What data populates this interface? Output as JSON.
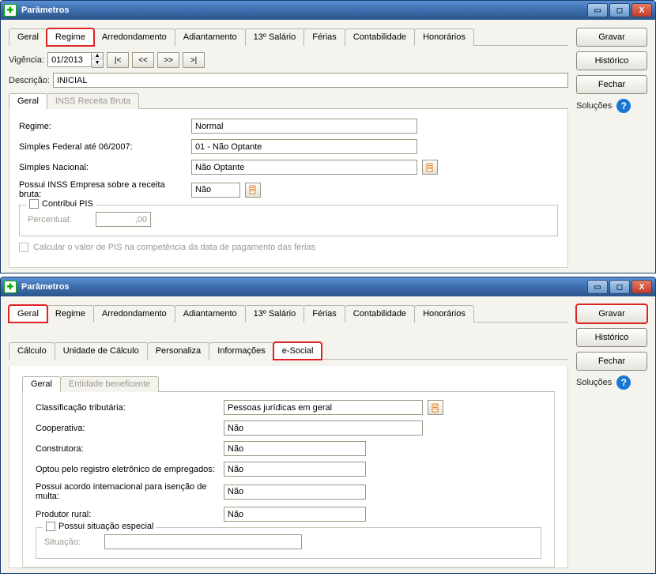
{
  "window_title": "Parâmetros",
  "window_buttons": {
    "min": "▭",
    "max": "◻",
    "close": "X"
  },
  "top": {
    "tabs": [
      "Geral",
      "Regime",
      "Arredondamento",
      "Adiantamento",
      "13º Salário",
      "Férias",
      "Contabilidade",
      "Honorários"
    ],
    "active_tab": 1,
    "vigencia_label": "Vigência:",
    "vigencia_value": "01/2013",
    "nav": {
      "first": "|<",
      "prev": "<<",
      "next": ">>",
      "last": ">|"
    },
    "descricao_label": "Descrição:",
    "descricao_value": "INICIAL",
    "subtabs": [
      "Geral",
      "INSS Receita Bruta"
    ],
    "subtab_active": 0,
    "fields": {
      "regime_label": "Regime:",
      "regime_value": "Normal",
      "simples_fed_label": "Simples Federal até 06/2007:",
      "simples_fed_value": "01 - Não Optante",
      "simples_nac_label": "Simples Nacional:",
      "simples_nac_value": "Não Optante",
      "inss_receita_label": "Possui INSS Empresa sobre a receita bruta:",
      "inss_receita_value": "Não",
      "contribui_pis_label": "Contribui PIS",
      "percentual_label": "Percentual:",
      "percentual_value": ",00",
      "calcular_pis_label": "Calcular o valor de PIS na competência da data de pagamento das férias"
    },
    "side": {
      "gravar": "Gravar",
      "historico": "Histórico",
      "fechar": "Fechar",
      "solucoes": "Soluções"
    }
  },
  "bottom": {
    "tabs": [
      "Geral",
      "Regime",
      "Arredondamento",
      "Adiantamento",
      "13º Salário",
      "Férias",
      "Contabilidade",
      "Honorários"
    ],
    "active_tab": 0,
    "tabs2": [
      "Cálculo",
      "Unidade de Cálculo",
      "Personaliza",
      "Informações",
      "e-Social"
    ],
    "active_tab2": 4,
    "subtabs": [
      "Geral",
      "Entidade beneficente"
    ],
    "subtab_active": 0,
    "fields": {
      "classificacao_label": "Classificação tributária:",
      "classificacao_value": "Pessoas jurídicas em geral",
      "cooperativa_label": "Cooperativa:",
      "cooperativa_value": "Não",
      "construtora_label": "Construtora:",
      "construtora_value": "Não",
      "registro_label": "Optou pelo registro eletrônico de empregados:",
      "registro_value": "Não",
      "acordo_label": "Possui acordo internacional para isenção de multa:",
      "acordo_value": "Não",
      "produtor_label": "Produtor rural:",
      "produtor_value": "Não",
      "situacao_legend": "Possui situação especial",
      "situacao_label": "Situação:"
    },
    "side": {
      "gravar": "Gravar",
      "historico": "Histórico",
      "fechar": "Fechar",
      "solucoes": "Soluções"
    }
  }
}
